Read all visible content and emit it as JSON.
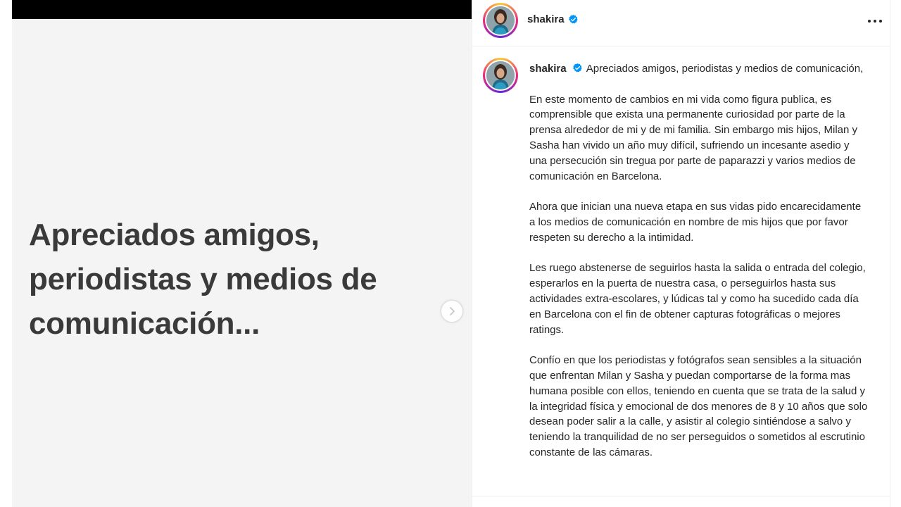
{
  "media": {
    "heading": "Apreciados amigos, periodistas y  medios de comunicación..."
  },
  "post": {
    "username": "shakira",
    "verified": true,
    "caption": {
      "intro": "Apreciados amigos, periodistas y medios de comunicación,",
      "paragraphs": [
        "En este momento de cambios en mi vida como figura publica, es comprensible que exista una permanente curiosidad por parte de la prensa alrededor de mi y de mi familia. Sin embargo mis hijos, Milan y Sasha han vivido un año muy difícil, sufriendo un incesante asedio y una persecución sin tregua por parte de paparazzi y varios medios de comunicación en Barcelona.",
        "Ahora que inician una nueva etapa en sus vidas pido encarecidamente a los medios de comunicación en nombre de mis hijos que por favor respeten su derecho a la intimidad.",
        "Les ruego abstenerse de seguirlos hasta la salida o entrada del colegio, esperarlos en la puerta de nuestra casa, o perseguirlos hasta sus actividades extra-escolares, y lúdicas tal y como ha sucedido cada día en Barcelona con el fin de obtener capturas fotográficas o mejores ratings.",
        "Confío en que los periodistas y fotógrafos sean sensibles a la situación que enfrentan Milan y Sasha y puedan comportarse de la forma mas humana posible con ellos, teniendo en cuenta que se trata de la salud y la integridad física y emocional de dos menores de 8 y 10 años que solo desean poder salir a la calle, y asistir al colegio sintiéndose a salvo y teniendo la tranquilidad de no ser perseguidos o sometidos al escrutinio constante de las cámaras."
      ]
    }
  },
  "icons": {
    "verified": "verified-badge-icon",
    "more": "more-options-icon",
    "next": "chevron-right-icon"
  },
  "colors": {
    "verified_blue": "#0095f6",
    "text": "#262626",
    "heading": "#3a3a3a",
    "media_bg": "#f4f4f4"
  }
}
